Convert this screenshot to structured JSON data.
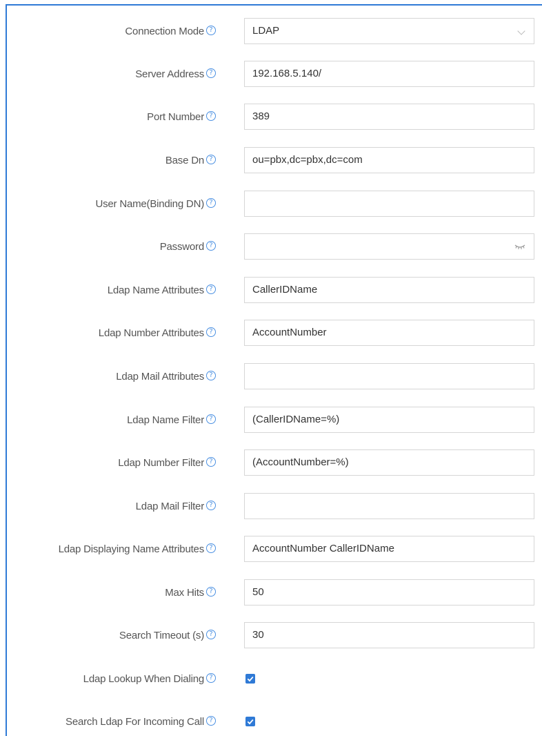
{
  "colors": {
    "accent": "#2f7ad6",
    "border": "#d6d6d6",
    "label": "#555555"
  },
  "help_glyph": "?",
  "fields": [
    {
      "label": "Connection Mode",
      "value": "LDAP",
      "type": "select"
    },
    {
      "label": "Server Address",
      "value": "192.168.5.140/",
      "type": "text"
    },
    {
      "label": "Port Number",
      "value": "389",
      "type": "text"
    },
    {
      "label": "Base Dn",
      "value": "ou=pbx,dc=pbx,dc=com",
      "type": "text"
    },
    {
      "label": "User Name(Binding DN)",
      "value": "",
      "type": "text"
    },
    {
      "label": "Password",
      "value": "",
      "type": "password"
    },
    {
      "label": "Ldap Name Attributes",
      "value": "CallerIDName",
      "type": "text"
    },
    {
      "label": "Ldap Number Attributes",
      "value": "AccountNumber",
      "type": "text"
    },
    {
      "label": "Ldap Mail Attributes",
      "value": "",
      "type": "text"
    },
    {
      "label": "Ldap Name Filter",
      "value": "(CallerIDName=%)",
      "type": "text"
    },
    {
      "label": "Ldap Number Filter",
      "value": "(AccountNumber=%)",
      "type": "text"
    },
    {
      "label": "Ldap Mail Filter",
      "value": "",
      "type": "text"
    },
    {
      "label": "Ldap Displaying Name Attributes",
      "value": "AccountNumber CallerIDName",
      "type": "text"
    },
    {
      "label": "Max Hits",
      "value": "50",
      "type": "text"
    },
    {
      "label": "Search Timeout (s)",
      "value": "30",
      "type": "text"
    }
  ],
  "checkboxes": [
    {
      "label": "Ldap Lookup When Dialing",
      "checked": true
    },
    {
      "label": "Search Ldap For Incoming Call",
      "checked": true
    }
  ]
}
